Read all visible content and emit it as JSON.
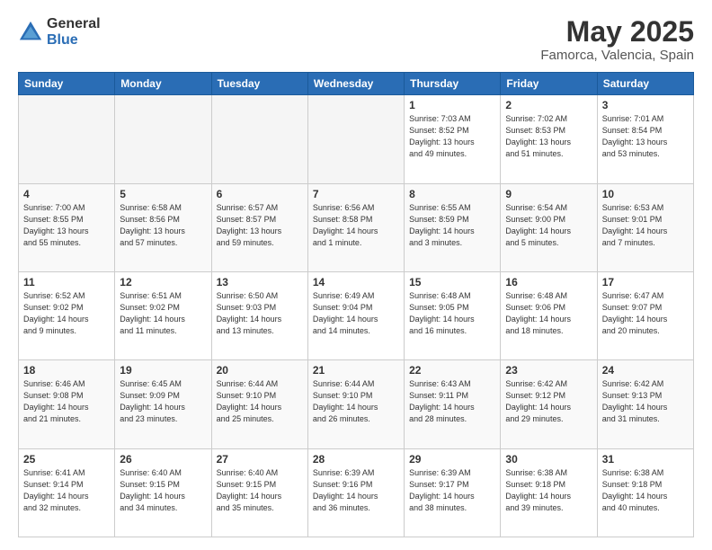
{
  "header": {
    "logo_general": "General",
    "logo_blue": "Blue",
    "month_title": "May 2025",
    "location": "Famorca, Valencia, Spain"
  },
  "weekdays": [
    "Sunday",
    "Monday",
    "Tuesday",
    "Wednesday",
    "Thursday",
    "Friday",
    "Saturday"
  ],
  "weeks": [
    [
      {
        "day": "",
        "info": ""
      },
      {
        "day": "",
        "info": ""
      },
      {
        "day": "",
        "info": ""
      },
      {
        "day": "",
        "info": ""
      },
      {
        "day": "1",
        "info": "Sunrise: 7:03 AM\nSunset: 8:52 PM\nDaylight: 13 hours\nand 49 minutes."
      },
      {
        "day": "2",
        "info": "Sunrise: 7:02 AM\nSunset: 8:53 PM\nDaylight: 13 hours\nand 51 minutes."
      },
      {
        "day": "3",
        "info": "Sunrise: 7:01 AM\nSunset: 8:54 PM\nDaylight: 13 hours\nand 53 minutes."
      }
    ],
    [
      {
        "day": "4",
        "info": "Sunrise: 7:00 AM\nSunset: 8:55 PM\nDaylight: 13 hours\nand 55 minutes."
      },
      {
        "day": "5",
        "info": "Sunrise: 6:58 AM\nSunset: 8:56 PM\nDaylight: 13 hours\nand 57 minutes."
      },
      {
        "day": "6",
        "info": "Sunrise: 6:57 AM\nSunset: 8:57 PM\nDaylight: 13 hours\nand 59 minutes."
      },
      {
        "day": "7",
        "info": "Sunrise: 6:56 AM\nSunset: 8:58 PM\nDaylight: 14 hours\nand 1 minute."
      },
      {
        "day": "8",
        "info": "Sunrise: 6:55 AM\nSunset: 8:59 PM\nDaylight: 14 hours\nand 3 minutes."
      },
      {
        "day": "9",
        "info": "Sunrise: 6:54 AM\nSunset: 9:00 PM\nDaylight: 14 hours\nand 5 minutes."
      },
      {
        "day": "10",
        "info": "Sunrise: 6:53 AM\nSunset: 9:01 PM\nDaylight: 14 hours\nand 7 minutes."
      }
    ],
    [
      {
        "day": "11",
        "info": "Sunrise: 6:52 AM\nSunset: 9:02 PM\nDaylight: 14 hours\nand 9 minutes."
      },
      {
        "day": "12",
        "info": "Sunrise: 6:51 AM\nSunset: 9:02 PM\nDaylight: 14 hours\nand 11 minutes."
      },
      {
        "day": "13",
        "info": "Sunrise: 6:50 AM\nSunset: 9:03 PM\nDaylight: 14 hours\nand 13 minutes."
      },
      {
        "day": "14",
        "info": "Sunrise: 6:49 AM\nSunset: 9:04 PM\nDaylight: 14 hours\nand 14 minutes."
      },
      {
        "day": "15",
        "info": "Sunrise: 6:48 AM\nSunset: 9:05 PM\nDaylight: 14 hours\nand 16 minutes."
      },
      {
        "day": "16",
        "info": "Sunrise: 6:48 AM\nSunset: 9:06 PM\nDaylight: 14 hours\nand 18 minutes."
      },
      {
        "day": "17",
        "info": "Sunrise: 6:47 AM\nSunset: 9:07 PM\nDaylight: 14 hours\nand 20 minutes."
      }
    ],
    [
      {
        "day": "18",
        "info": "Sunrise: 6:46 AM\nSunset: 9:08 PM\nDaylight: 14 hours\nand 21 minutes."
      },
      {
        "day": "19",
        "info": "Sunrise: 6:45 AM\nSunset: 9:09 PM\nDaylight: 14 hours\nand 23 minutes."
      },
      {
        "day": "20",
        "info": "Sunrise: 6:44 AM\nSunset: 9:10 PM\nDaylight: 14 hours\nand 25 minutes."
      },
      {
        "day": "21",
        "info": "Sunrise: 6:44 AM\nSunset: 9:10 PM\nDaylight: 14 hours\nand 26 minutes."
      },
      {
        "day": "22",
        "info": "Sunrise: 6:43 AM\nSunset: 9:11 PM\nDaylight: 14 hours\nand 28 minutes."
      },
      {
        "day": "23",
        "info": "Sunrise: 6:42 AM\nSunset: 9:12 PM\nDaylight: 14 hours\nand 29 minutes."
      },
      {
        "day": "24",
        "info": "Sunrise: 6:42 AM\nSunset: 9:13 PM\nDaylight: 14 hours\nand 31 minutes."
      }
    ],
    [
      {
        "day": "25",
        "info": "Sunrise: 6:41 AM\nSunset: 9:14 PM\nDaylight: 14 hours\nand 32 minutes."
      },
      {
        "day": "26",
        "info": "Sunrise: 6:40 AM\nSunset: 9:15 PM\nDaylight: 14 hours\nand 34 minutes."
      },
      {
        "day": "27",
        "info": "Sunrise: 6:40 AM\nSunset: 9:15 PM\nDaylight: 14 hours\nand 35 minutes."
      },
      {
        "day": "28",
        "info": "Sunrise: 6:39 AM\nSunset: 9:16 PM\nDaylight: 14 hours\nand 36 minutes."
      },
      {
        "day": "29",
        "info": "Sunrise: 6:39 AM\nSunset: 9:17 PM\nDaylight: 14 hours\nand 38 minutes."
      },
      {
        "day": "30",
        "info": "Sunrise: 6:38 AM\nSunset: 9:18 PM\nDaylight: 14 hours\nand 39 minutes."
      },
      {
        "day": "31",
        "info": "Sunrise: 6:38 AM\nSunset: 9:18 PM\nDaylight: 14 hours\nand 40 minutes."
      }
    ]
  ]
}
